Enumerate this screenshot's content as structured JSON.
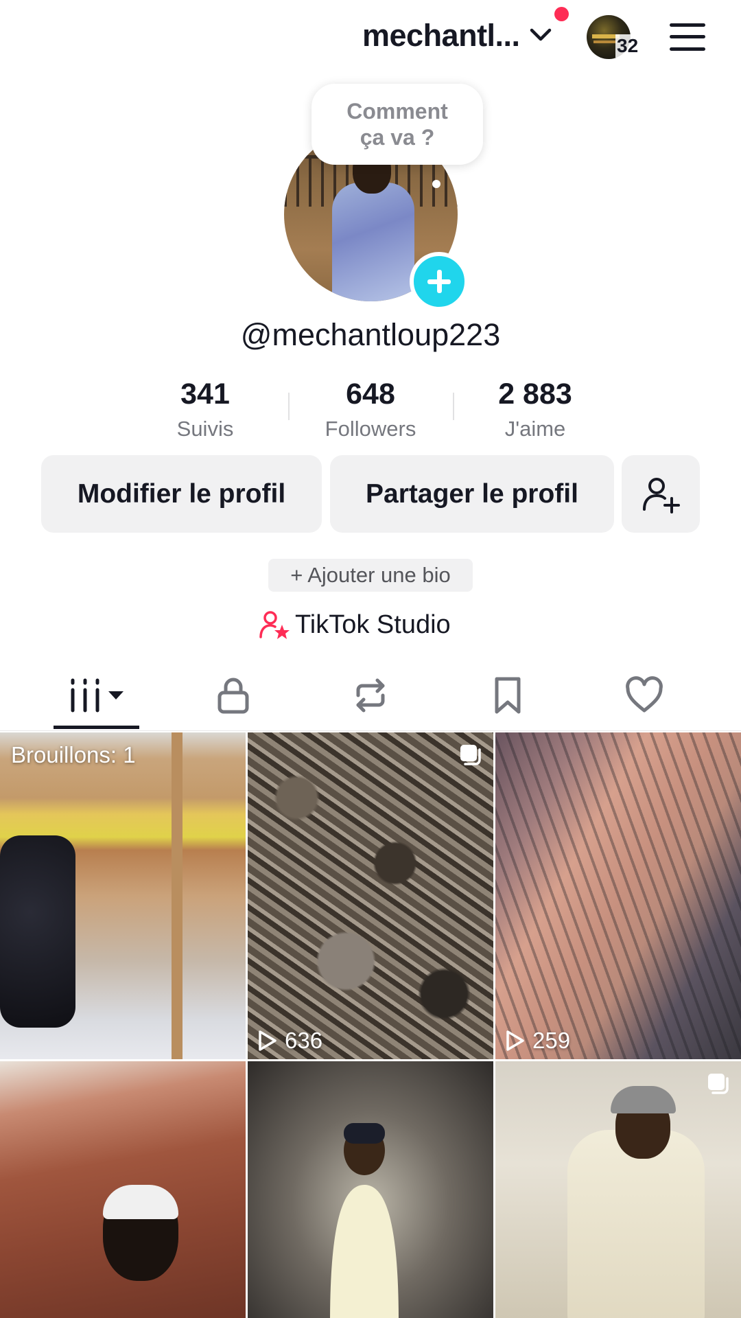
{
  "header": {
    "username": "mechantl...",
    "inbox_badge_count": "32",
    "colors": {
      "notification_dot": "#fe2c55"
    }
  },
  "profile": {
    "status_bubble": "Comment ça va ?",
    "handle": "@mechantloup223",
    "add_button_color": "#20d5ec"
  },
  "stats": [
    {
      "value": "341",
      "label": "Suivis"
    },
    {
      "value": "648",
      "label": "Followers"
    },
    {
      "value": "2 883",
      "label": "J'aime"
    }
  ],
  "actions": {
    "edit_profile": "Modifier le profil",
    "share_profile": "Partager le profil",
    "add_friend_icon": "add-user-icon"
  },
  "bio": {
    "add_bio": "+ Ajouter une bio"
  },
  "studio": {
    "label": "TikTok Studio",
    "icon_color": "#fe2c55"
  },
  "tabs": [
    {
      "icon": "videos-grid-icon",
      "active": true
    },
    {
      "icon": "lock-icon"
    },
    {
      "icon": "repost-icon"
    },
    {
      "icon": "bookmark-icon"
    },
    {
      "icon": "heart-icon"
    }
  ],
  "grid": {
    "drafts_label": "Brouillons: 1",
    "items": [
      {
        "views": ""
      },
      {
        "views": "636",
        "multi": true
      },
      {
        "views": "259"
      },
      {
        "views": ""
      },
      {
        "views": ""
      },
      {
        "views": "",
        "multi": true
      }
    ]
  }
}
